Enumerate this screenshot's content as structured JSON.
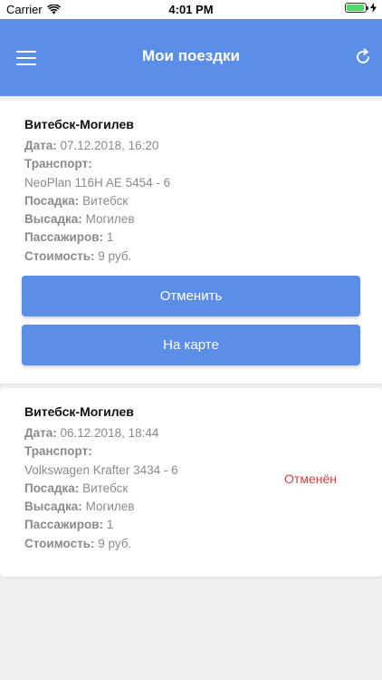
{
  "status_bar": {
    "carrier": "Carrier",
    "time": "4:01 PM",
    "wifi_icon": "wifi-icon",
    "battery_icon": "battery-full-icon"
  },
  "navbar": {
    "title": "Мои поездки",
    "menu_icon": "hamburger-menu-icon",
    "refresh_icon": "refresh-icon"
  },
  "colors": {
    "accent": "#5b8ee6",
    "status_cancelled": "#e23a3a",
    "background": "#efefef"
  },
  "trips": [
    {
      "route": "Витебск-Могилев",
      "date_label": "Дата:",
      "date_value": "07.12.2018, 16:20",
      "transport_label": "Транспорт:",
      "transport_value": "NeoPlan 116H AE 5454 - 6",
      "boarding_label": "Посадка:",
      "boarding_value": "Витебск",
      "dropoff_label": "Высадка:",
      "dropoff_value": "Могилев",
      "passengers_label": "Пассажиров:",
      "passengers_value": "1",
      "cost_label": "Стоимость:",
      "cost_value": "9 руб.",
      "cancel_button": "Отменить",
      "map_button": "На карте"
    },
    {
      "route": "Витебск-Могилев",
      "date_label": "Дата:",
      "date_value": "06.12.2018, 18:44",
      "transport_label": "Транспорт:",
      "transport_value": "Volkswagen Krafter 3434 - 6",
      "boarding_label": "Посадка:",
      "boarding_value": "Витебск",
      "dropoff_label": "Высадка:",
      "dropoff_value": "Могилев",
      "passengers_label": "Пассажиров:",
      "passengers_value": "1",
      "cost_label": "Стоимость:",
      "cost_value": "9 руб.",
      "status": "Отменён"
    }
  ]
}
